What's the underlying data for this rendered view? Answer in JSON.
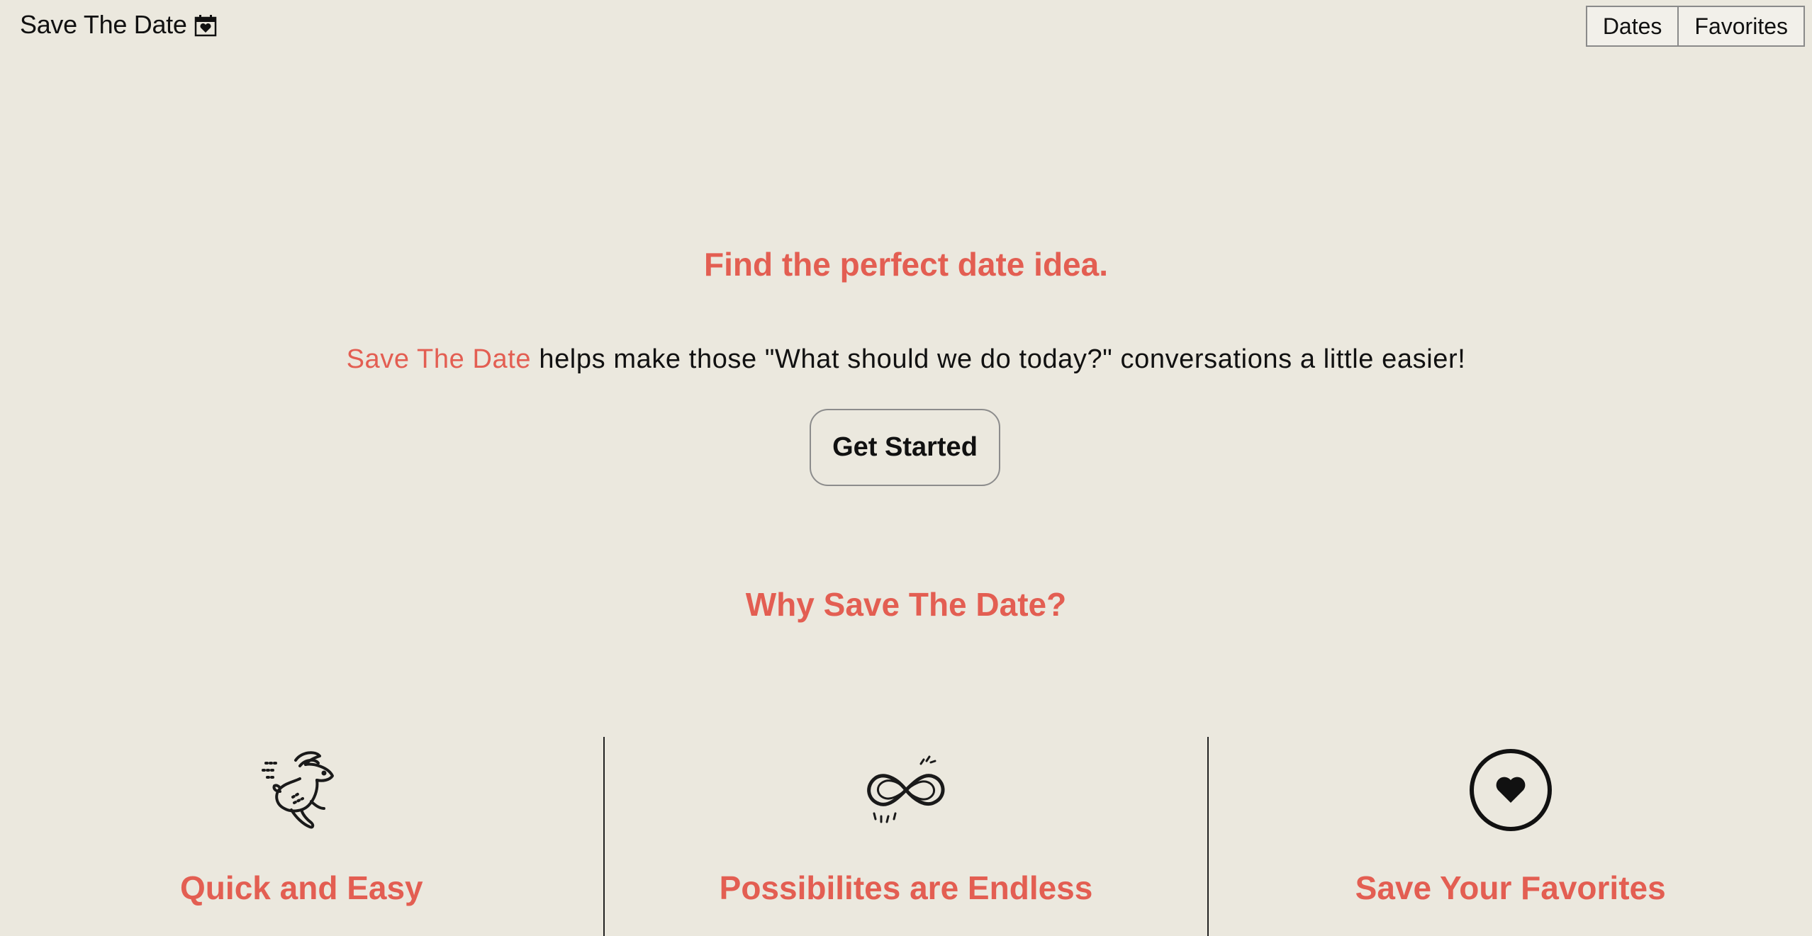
{
  "header": {
    "brand": "Save The Date",
    "brand_icon": "calendar-heart-icon",
    "nav": [
      {
        "label": "Dates"
      },
      {
        "label": "Favorites"
      }
    ]
  },
  "hero": {
    "title": "Find the perfect date idea.",
    "subtitle_accent": "Save The Date",
    "subtitle_rest": " helps make those \"What should we do today?\" conversations a little easier!",
    "cta_label": "Get Started"
  },
  "why": {
    "title": "Why Save The Date?",
    "features": [
      {
        "icon": "running-rabbit-icon",
        "title": "Quick and Easy"
      },
      {
        "icon": "infinity-icon",
        "title": "Possibilites are Endless"
      },
      {
        "icon": "heart-circle-icon",
        "title": "Save Your Favorites"
      }
    ]
  },
  "colors": {
    "background": "#ebe8de",
    "accent": "#e35e52",
    "text": "#111111"
  }
}
